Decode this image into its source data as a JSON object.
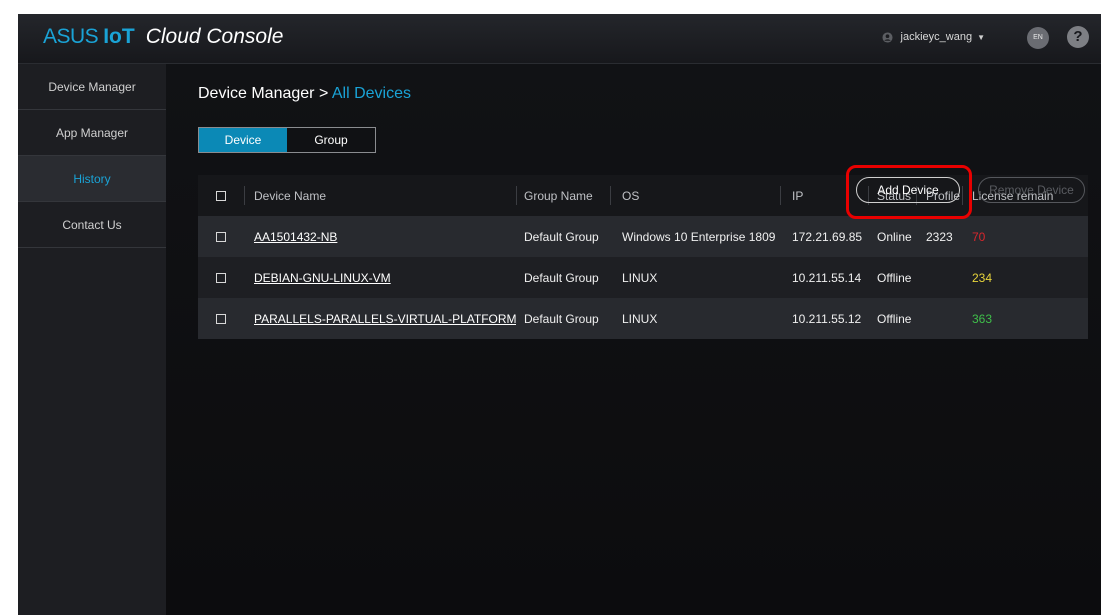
{
  "header": {
    "logo_brand": "ASUS",
    "logo_iot": "IoT",
    "logo_product": "Cloud Console",
    "username": "jackieyc_wang",
    "language": "EN",
    "help": "?"
  },
  "sidebar": {
    "items": [
      {
        "label": "Device Manager"
      },
      {
        "label": "App Manager"
      },
      {
        "label": "History",
        "active": true
      },
      {
        "label": "Contact Us"
      }
    ]
  },
  "breadcrumb": {
    "root": "Device Manager",
    "separator": " > ",
    "current": "All Devices"
  },
  "tabs": [
    {
      "label": "Device",
      "active": true
    },
    {
      "label": "Group",
      "active": false
    }
  ],
  "actions": {
    "add_device": "Add Device",
    "remove_device": "Remove Device"
  },
  "table": {
    "columns": [
      "Device Name",
      "Group Name",
      "OS",
      "IP",
      "Status",
      "Profile",
      "License remain"
    ],
    "rows": [
      {
        "name": "AA1501432-NB",
        "group": "Default Group",
        "os": "Windows 10 Enterprise 1809",
        "ip": "172.21.69.85",
        "status": "Online",
        "profile": "2323",
        "license": "70",
        "license_color": "#d9262c"
      },
      {
        "name": "DEBIAN-GNU-LINUX-VM",
        "group": "Default Group",
        "os": "LINUX",
        "ip": "10.211.55.14",
        "status": "Offline",
        "profile": "",
        "license": "234",
        "license_color": "#e7d43b"
      },
      {
        "name": "PARALLELS-PARALLELS-VIRTUAL-PLATFORM",
        "group": "Default Group",
        "os": "LINUX",
        "ip": "10.211.55.12",
        "status": "Offline",
        "profile": "",
        "license": "363",
        "license_color": "#3fbf4a"
      }
    ]
  },
  "colors": {
    "accent": "#1aa3d6",
    "tab_active": "#0b89b6",
    "highlight": "#e80000"
  }
}
